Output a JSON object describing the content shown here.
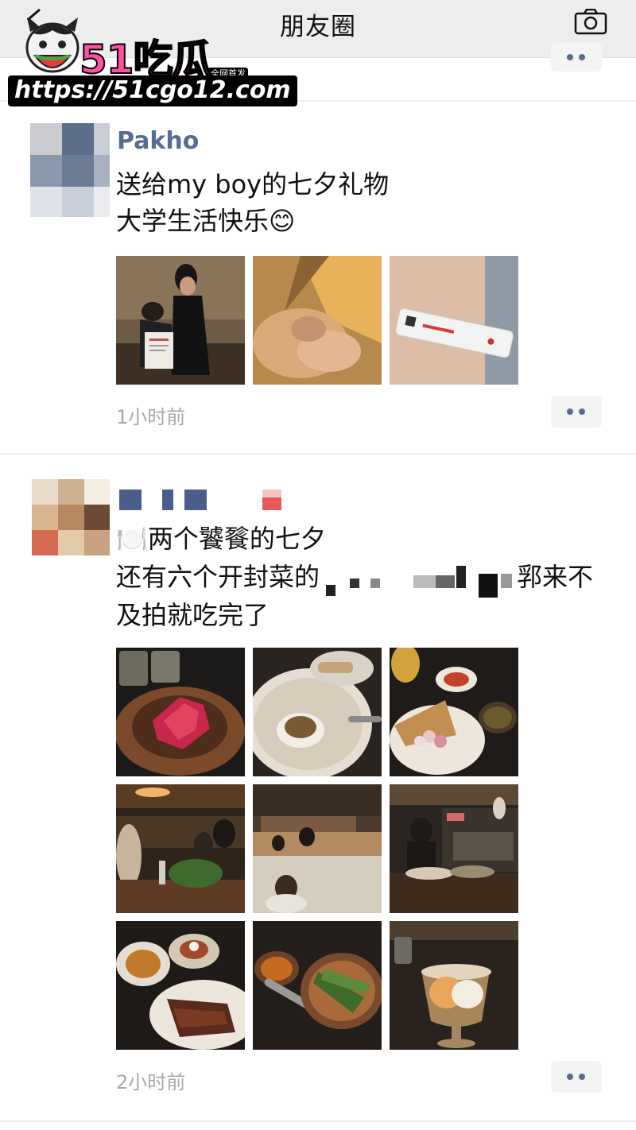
{
  "nav": {
    "title": "朋友圈",
    "back_icon": "chevron-left-icon",
    "camera_icon": "camera-icon"
  },
  "watermark": {
    "brand": "51吃瓜",
    "badge": "全网首发",
    "url": "https://51cgo12.com"
  },
  "posts": [
    {
      "username": "Pakho",
      "lines": [
        "送给my boy的七夕礼物",
        "大学生活快乐😊"
      ],
      "photos": [
        "couple-photo",
        "hands-photo",
        "test-strip-photo"
      ],
      "time": "1小时前"
    },
    {
      "username": "",
      "lines": [
        "🍽️两个饕餮的七夕",
        "还有六个开封菜的",
        "郛来不",
        "及拍就吃完了"
      ],
      "photos": [
        "meat-plate",
        "plated-dish",
        "flatbread-plate",
        "restaurant-interior-1",
        "restaurant-interior-2",
        "open-kitchen",
        "dinner-table-1",
        "dinner-table-2",
        "dessert-cup"
      ],
      "time": "2小时前"
    }
  ],
  "colors": {
    "link_blue": "#576b95",
    "nav_bg": "#ededed",
    "timestamp_gray": "#a8a8a8"
  }
}
